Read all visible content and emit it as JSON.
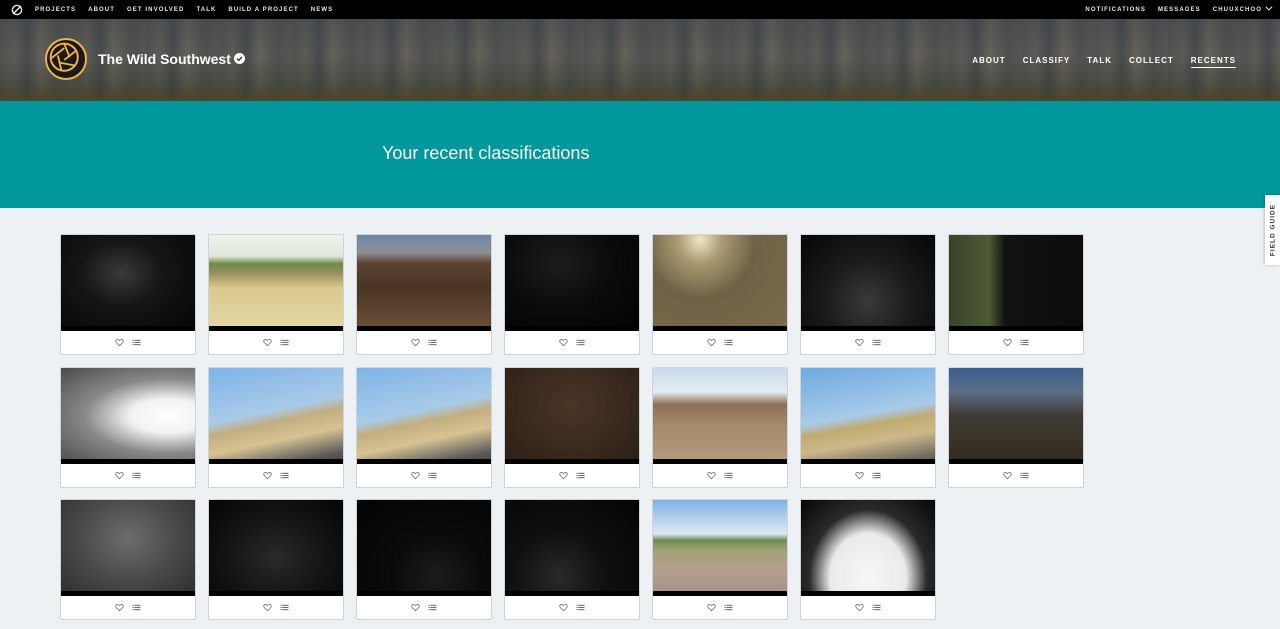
{
  "site_nav": {
    "left": [
      "PROJECTS",
      "ABOUT",
      "GET INVOLVED",
      "TALK",
      "BUILD A PROJECT",
      "NEWS"
    ],
    "notifications": "NOTIFICATIONS",
    "messages": "MESSAGES",
    "user": "CHUUXCHOO"
  },
  "project": {
    "title": "The Wild Southwest",
    "nav": [
      "ABOUT",
      "CLASSIFY",
      "TALK",
      "COLLECT",
      "RECENTS"
    ],
    "active_nav": "RECENTS"
  },
  "page_title": "Your recent classifications",
  "field_guide_label": "FIELD GUIDE",
  "colors": {
    "topbar": "#000000",
    "banner": "#00979d",
    "logo_ring": "#f0b24a",
    "page_background": "#eef1f4"
  },
  "recents": [
    {
      "scene": "night-deer"
    },
    {
      "scene": "grassland-day"
    },
    {
      "scene": "brush-deer"
    },
    {
      "scene": "night-dark"
    },
    {
      "scene": "sunlit-deer"
    },
    {
      "scene": "night-fog"
    },
    {
      "scene": "closeup-animal"
    },
    {
      "scene": "overexposed-white"
    },
    {
      "scene": "tilted-field"
    },
    {
      "scene": "tilted-field"
    },
    {
      "scene": "dirt-ground"
    },
    {
      "scene": "road-trees"
    },
    {
      "scene": "field-birds"
    },
    {
      "scene": "bare-trees"
    },
    {
      "scene": "gray-trees"
    },
    {
      "scene": "night-ground"
    },
    {
      "scene": "night-black"
    },
    {
      "scene": "night-fence"
    },
    {
      "scene": "road-clouds"
    },
    {
      "scene": "white-fur"
    }
  ],
  "card_actions": {
    "favorite_icon": "heart-icon",
    "collect_icon": "list-icon"
  }
}
